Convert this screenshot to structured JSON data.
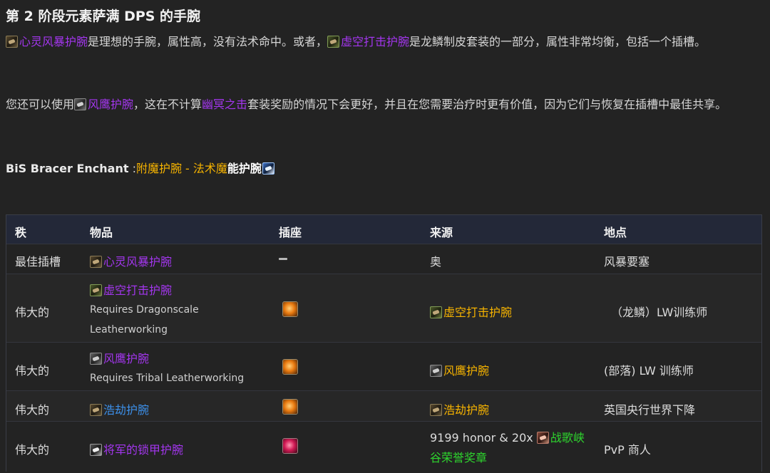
{
  "heading": "第 2 阶段元素萨满 DPS 的手腕",
  "intro": {
    "item1": "心灵风暴护腕",
    "text1": "是理想的手腕，属性高，没有法术命中。或者，",
    "item2": "虚空打击护腕",
    "text2": "是龙鳞制皮套装的一部分，属性非常均衡，包括一个插槽。"
  },
  "alt": {
    "text1": "您还可以使用",
    "item": "风鹰护腕",
    "text2": "，这在不计算",
    "setname": "幽冥之击",
    "text3": "套装奖励的情况下会更好，并且在您需要治疗时更有价值，因为它们与恢复在插槽中最佳共享。"
  },
  "bis": {
    "label": "BiS Bracer Enchant",
    "sep": " :",
    "enchant_gold": "附魔护腕 - 法术魔",
    "enchant_white": "能护腕"
  },
  "icons": {
    "item_bracer": "bracer-icon",
    "enchant": "enchant-scroll-icon",
    "orange_gem": "orange-gem-socket-icon",
    "red_gem": "red-gem-socket-icon",
    "mark": "battleground-mark-icon"
  },
  "table": {
    "headers": {
      "rank": "秩",
      "item": "物品",
      "socket": "插座",
      "source": "来源",
      "location": "地点"
    },
    "rows": [
      {
        "rank": "最佳插槽",
        "item": "心灵风暴护腕",
        "socket": "–",
        "source": "奥",
        "location": "风暴要塞"
      },
      {
        "rank": "伟大的",
        "item": "虚空打击护腕",
        "req1": "Requires Dragonscale",
        "req2": "Leatherworking",
        "source": "虚空打击护腕",
        "location": "（龙鳞）LW训练师"
      },
      {
        "rank": "伟大的",
        "item": "风鹰护腕",
        "req1": "Requires Tribal Leatherworking",
        "source": "风鹰护腕",
        "location": "(部落) LW 训练师"
      },
      {
        "rank": "伟大的",
        "item": "浩劫护腕",
        "source": "浩劫护腕",
        "location": "英国央行世界下降"
      },
      {
        "rank": "伟大的",
        "item": "将军的锁甲护腕",
        "source_text": "9199 honor & 20x",
        "source_link1": "战歌峡",
        "source_link2": "谷荣誉奖章",
        "location": "PvP 商人"
      }
    ]
  },
  "colors": {
    "epic": "#a336ee",
    "rare": "#3c8fe8",
    "gold": "#f6b300",
    "green": "#2ed52e",
    "header_bg": "#232838"
  }
}
